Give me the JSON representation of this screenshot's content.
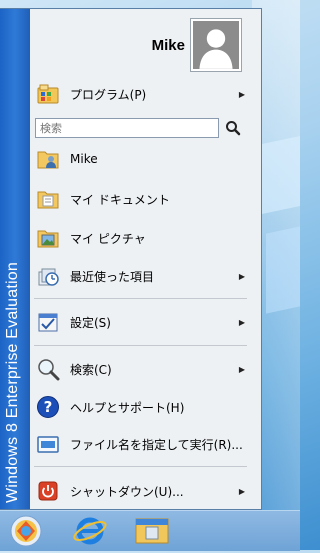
{
  "side_band": {
    "text": "Windows 8 Enterprise Evaluation"
  },
  "user": {
    "name": "Mike"
  },
  "search": {
    "placeholder": "検索"
  },
  "items": [
    {
      "label": "プログラム(P)",
      "icon": "programs-icon",
      "arrow": true
    },
    {
      "label": "Mike",
      "icon": "user-folder-icon",
      "arrow": false
    },
    {
      "label": "マイ ドキュメント",
      "icon": "documents-folder-icon",
      "arrow": false
    },
    {
      "label": "マイ ピクチャ",
      "icon": "pictures-folder-icon",
      "arrow": false
    },
    {
      "label": "最近使った項目",
      "icon": "recent-items-icon",
      "arrow": true
    },
    {
      "label": "設定(S)",
      "icon": "settings-icon",
      "arrow": true
    },
    {
      "label": "検索(C)",
      "icon": "magnifier-icon",
      "arrow": true
    },
    {
      "label": "ヘルプとサポート(H)",
      "icon": "help-icon",
      "arrow": false
    },
    {
      "label": "ファイル名を指定して実行(R)...",
      "icon": "run-icon",
      "arrow": false
    },
    {
      "label": "シャットダウン(U)...",
      "icon": "shutdown-icon",
      "arrow": true
    }
  ],
  "taskbar": [
    {
      "name": "start-orb-icon"
    },
    {
      "name": "internet-explorer-icon"
    },
    {
      "name": "file-explorer-icon"
    }
  ],
  "colors": {
    "band": "#2f7ad7",
    "menu_bg": "#eef1f4"
  }
}
